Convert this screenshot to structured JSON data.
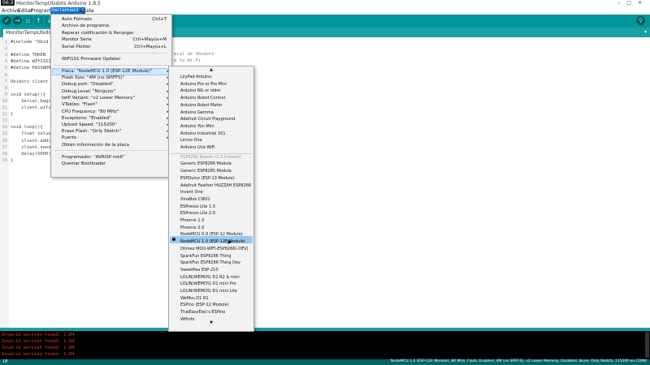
{
  "window": {
    "time": "06:3",
    "title": "MonitorTempUbidots Arduino 1.8.5",
    "controls": [
      "–",
      "□",
      "✕"
    ]
  },
  "menubar": {
    "items": [
      "Archivo",
      "Editar",
      "Programa",
      "Herramientas",
      "Ayuda"
    ]
  },
  "toolbar": {
    "verify_icon": "check-icon",
    "upload_icon": "arrow-right-icon",
    "new_icon": "new-file-icon",
    "open_icon": "arrow-up-icon",
    "save_icon": "arrow-down-icon",
    "serial_icon": "magnifier-icon"
  },
  "tabs": {
    "active": "MonitorTempUbidots",
    "menu_arrow": "▾"
  },
  "editor": {
    "lines": [
      {
        "no": "1",
        "text": "#include \"Ubid"
      },
      {
        "no": "2",
        "text": ""
      },
      {
        "no": "3",
        "text": "#define TOKEN"
      },
      {
        "no": "4",
        "text": "#define WIFISSI"
      },
      {
        "no": "5",
        "text": "#define PASSWOR"
      },
      {
        "no": "6",
        "text": ""
      },
      {
        "no": "7",
        "text": "Ubidots client"
      },
      {
        "no": "8",
        "text": ""
      },
      {
        "no": "9",
        "text": "void setup(){"
      },
      {
        "no": "10",
        "text": "    Serial.begi"
      },
      {
        "no": "11",
        "text": "    client.wifi"
      },
      {
        "no": "12",
        "text": "}"
      },
      {
        "no": "13",
        "text": ""
      },
      {
        "no": "14",
        "text": "void loop(){"
      },
      {
        "no": "15",
        "text": "    float value"
      },
      {
        "no": "16",
        "text": "    client.add("
      },
      {
        "no": "17",
        "text": "    client.send"
      },
      {
        "no": "18",
        "text": "    delay(5000)"
      },
      {
        "no": "19",
        "text": "}"
      }
    ],
    "behind_menu_1": "eral de Ubidots",
    "behind_menu_2": "e to Wi-Fi"
  },
  "tools_menu": {
    "items": [
      {
        "label": "Auto Formato",
        "shortcut": "Ctrl+T"
      },
      {
        "label": "Archivo de programa.",
        "shortcut": ""
      },
      {
        "label": "Reparar codificación & Recargar.",
        "shortcut": ""
      },
      {
        "label": "Monitor Serie",
        "shortcut": "Ctrl+Mayús+M"
      },
      {
        "label": "Serial Plotter",
        "shortcut": "Ctrl+Mayús+L"
      },
      {
        "label": "WiFi101 Firmware Updater",
        "shortcut": ""
      },
      {
        "label": "Placa: \"NodeMCU 1.0 (ESP-12E Module)\"",
        "shortcut": ""
      },
      {
        "label": "Flash Size: \"4M (no SPIFFS)\"",
        "shortcut": ""
      },
      {
        "label": "Debug port: \"Disabled\"",
        "shortcut": ""
      },
      {
        "label": "Debug Level: \"Ninguno\"",
        "shortcut": ""
      },
      {
        "label": "IwIP Variant: \"v2 Lower Memory\"",
        "shortcut": ""
      },
      {
        "label": "VTables: \"Flash\"",
        "shortcut": ""
      },
      {
        "label": "CPU Frequency: \"80 MHz\"",
        "shortcut": ""
      },
      {
        "label": "Exceptions: \"Enabled\"",
        "shortcut": ""
      },
      {
        "label": "Upload Speed: \"115200\"",
        "shortcut": ""
      },
      {
        "label": "Erase Flash: \"Only Sketch\"",
        "shortcut": ""
      },
      {
        "label": "Puerto",
        "shortcut": ""
      },
      {
        "label": "Obtén información de la placa",
        "shortcut": ""
      },
      {
        "label": "Programador: \"AVRISP mkII\"",
        "shortcut": ""
      },
      {
        "label": "Quemar Bootloader",
        "shortcut": ""
      }
    ],
    "submenu_arrow": "▸"
  },
  "board_menu": {
    "scroll_up": "▲",
    "scroll_down": "▼",
    "items": [
      "LilyPad Arduino",
      "Arduino Pro or Pro Mini",
      "Arduino NG or older",
      "Arduino Robot Control",
      "Arduino Robot Motor",
      "Arduino Gemma",
      "Adafruit Circuit Playground",
      "Arduino Yún Mini",
      "Arduino Industrial 101",
      "Linino One",
      "Arduino Uno WiFi",
      "ESP8266 Boards (2.5.0-beta2)",
      "Generic ESP8266 Module",
      "Generic ESP8285 Module",
      "ESPDuino (ESP-13 Module)",
      "Adafruit Feather HUZZAH ESP8266",
      "Invent One",
      "XinaBox CW01",
      "ESPresso Lite 1.0",
      "ESPresso Lite 2.0",
      "Phoenix 1.0",
      "Phoenix 2.0",
      "NodeMCU 0.9 (ESP-12 Module)",
      "NodeMCU 1.0 (ESP-12E Module)",
      "Olimex MOD-WIFI-ESP8266(-DEV)",
      "SparkFun ESP8266 Thing",
      "SparkFun ESP8266 Thing Dev",
      "SweetPea ESP-210",
      "LOLIN(WEMOS) D1 R2 & mini",
      "LOLIN(WEMOS) D1 mini Pro",
      "LOLIN(WEMOS) D1 mini Lite",
      "WeMos D1 R1",
      "ESPino (ESP-12 Module)",
      "ThaiEasyElec's ESPino",
      "WifInfo"
    ]
  },
  "console": {
    "lines": [
      "Invalid version found: 1.04",
      "Invalid version found: 1.04",
      "Invalid version found: 1.04",
      "Invalid version found: 1.04"
    ]
  },
  "statusbar": {
    "line": "18",
    "board": "NodeMCU 1.0 (ESP-12E Module), 80 MHz, Flash, Enabled, 4M (no SPIFFS), v2 Lower Memory, Disabled, None, Only Sketch, 115200 en COM4"
  },
  "colors": {
    "teal": "#00979c",
    "dark_teal": "#006468",
    "highlight": "#99c9ef",
    "console_error": "#e3411e"
  }
}
